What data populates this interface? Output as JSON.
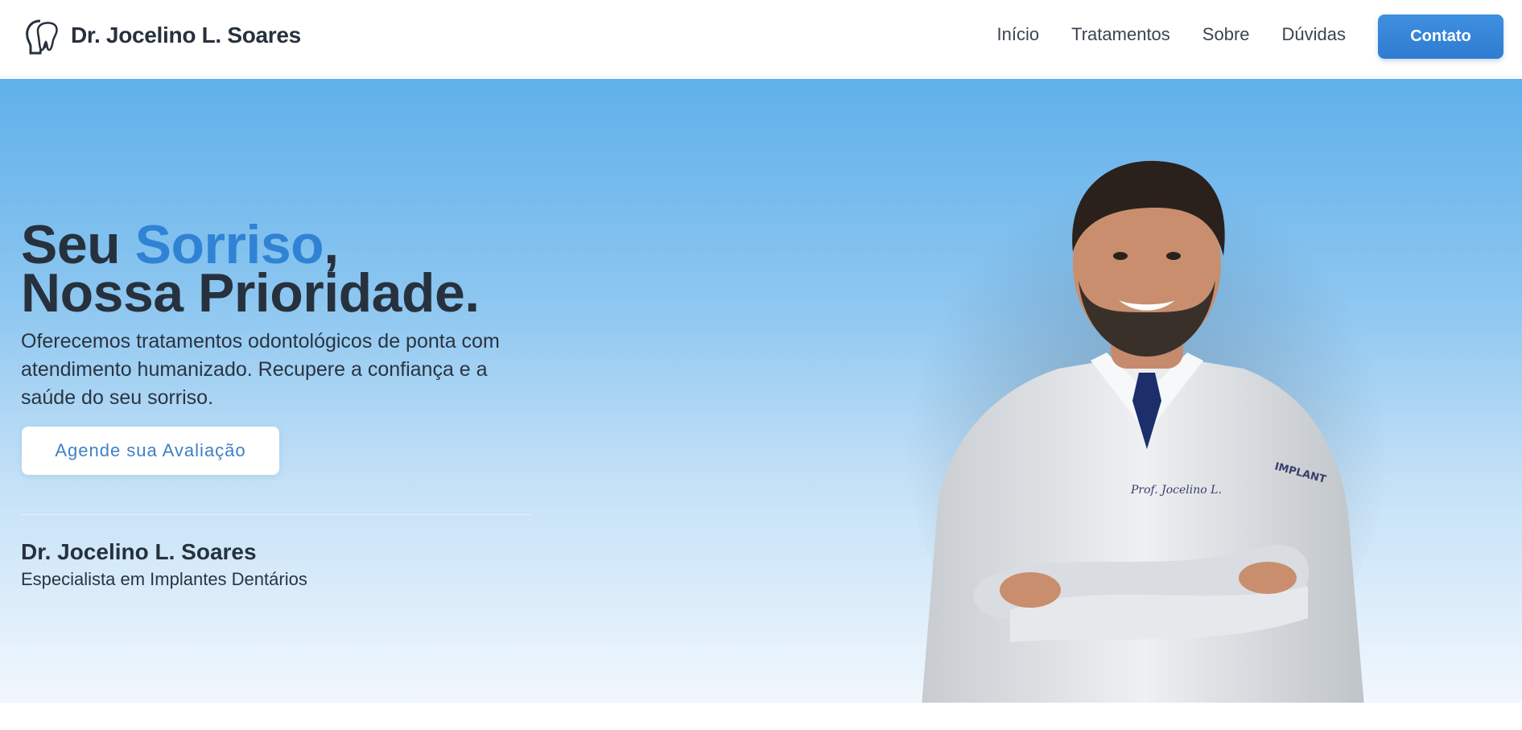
{
  "header": {
    "brand": "Dr. Jocelino L. Soares",
    "logo_icon": "tooth-head-icon",
    "nav": [
      "Início",
      "Tratamentos",
      "Sobre",
      "Dúvidas"
    ],
    "contact_label": "Contato"
  },
  "hero": {
    "title_part1": "Seu ",
    "title_accent": "Sorriso",
    "title_part2": ",",
    "title_line2": "Nossa Prioridade.",
    "lead": "Oferecemos tratamentos odontológicos de ponta com atendimento humanizado. Recupere a confiança e a saúde do seu sorriso.",
    "cta_label": "Agende sua Avaliação",
    "doctor_name": "Dr. Jocelino L. Soares",
    "doctor_role": "Especialista em Implantes Dentários",
    "accent_color": "#3083d4",
    "photo_text": {
      "badge": "IMPLANT",
      "pocket": "Prof. Jocelino L."
    }
  }
}
